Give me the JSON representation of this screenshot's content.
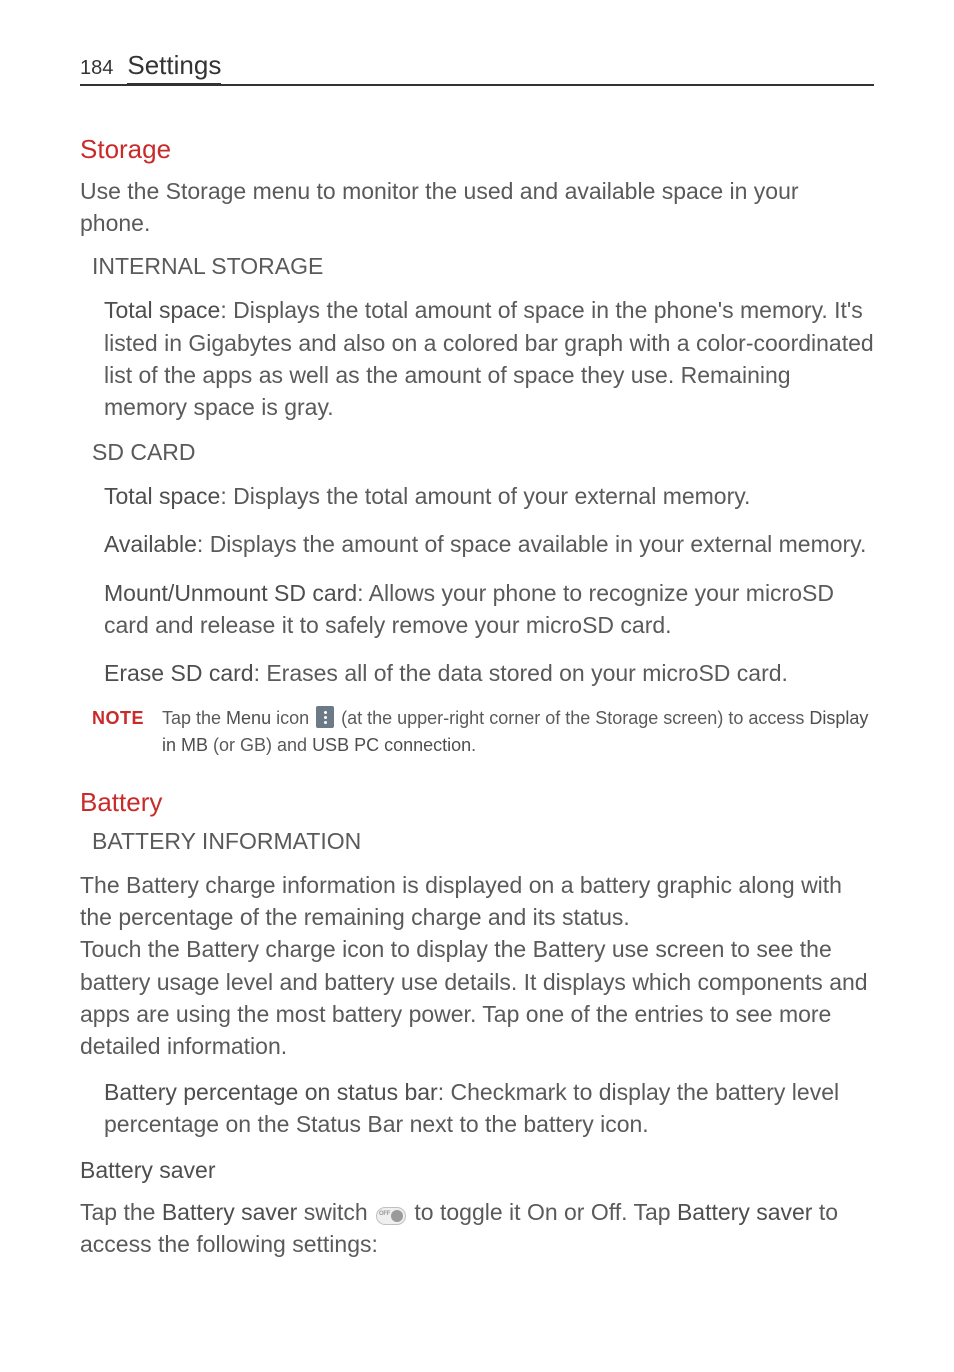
{
  "header": {
    "page_number": "184",
    "title": "Settings"
  },
  "storage": {
    "title": "Storage",
    "intro": "Use the Storage menu to monitor the used and available space in your phone.",
    "internal_heading": "INTERNAL STORAGE",
    "internal_total_label": "Total space",
    "internal_total_text": ": Displays the total amount of space in the phone's memory. It's listed in Gigabytes and also on a colored bar graph with a color-coordinated list of the apps as well as the amount of space they use. Remaining memory space is gray.",
    "sd_heading": "SD CARD",
    "sd_total_label": "Total space",
    "sd_total_text": ": Displays the total amount of your external memory.",
    "sd_available_label": "Available",
    "sd_available_text": ": Displays the amount of space available in your external memory.",
    "sd_mount_label": "Mount/Unmount SD card",
    "sd_mount_text": ": Allows your phone to recognize your microSD card and release it to safely remove your microSD card.",
    "sd_erase_label": "Erase SD card",
    "sd_erase_text": ": Erases all of the data stored on your microSD card.",
    "note_label": "NOTE",
    "note_pre": "Tap the ",
    "note_menu": "Menu",
    "note_mid1": " icon ",
    "note_mid2": " (at the upper-right corner of the Storage screen) to access ",
    "note_display": "Display in MB",
    "note_or": " (or GB) and ",
    "note_usb": "USB PC connection",
    "note_end": "."
  },
  "battery": {
    "title": "Battery",
    "info_heading": "BATTERY INFORMATION",
    "p1": "The Battery charge information is displayed on a battery graphic along with the percentage of the remaining charge and its status.",
    "p2": "Touch the Battery charge icon to display the Battery use screen to see the battery usage level and battery use details. It displays which components and apps are using the most battery power. Tap one of the entries to see more detailed information.",
    "bpct_label": "Battery percentage on status bar",
    "bpct_text": ": Checkmark to display the battery level percentage on the Status Bar next to the battery icon.",
    "saver_heading": "Battery saver",
    "saver_pre": "Tap the ",
    "saver_bold1": "Battery saver",
    "saver_mid1": " switch ",
    "saver_mid2": " to toggle it On or Off. Tap ",
    "saver_bold2": "Battery saver",
    "saver_end": " to access the following settings:"
  }
}
